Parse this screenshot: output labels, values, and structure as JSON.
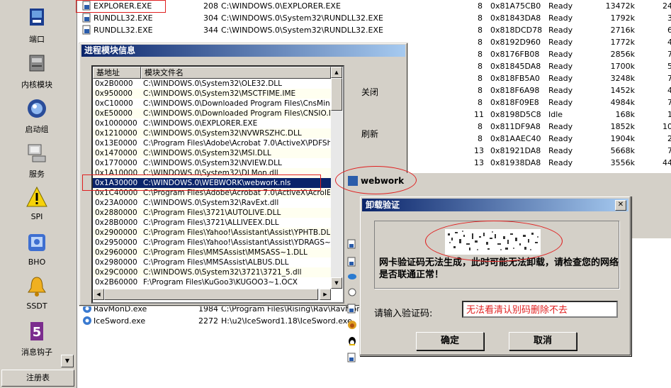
{
  "sidebar": {
    "items": [
      {
        "label": "端口",
        "icon": "port-icon"
      },
      {
        "label": "内核模块",
        "icon": "kernel-module-icon"
      },
      {
        "label": "启动组",
        "icon": "startup-group-icon"
      },
      {
        "label": "服务",
        "icon": "service-icon"
      },
      {
        "label": "SPI",
        "icon": "warning-icon"
      },
      {
        "label": "BHO",
        "icon": "bho-icon"
      },
      {
        "label": "SSDT",
        "icon": "bell-icon"
      },
      {
        "label": "消息钩子",
        "icon": "hook-icon"
      }
    ],
    "register_label": "注册表"
  },
  "processes": [
    {
      "name": "EXPLORER.EXE",
      "pid": "208",
      "path": "C:\\WINDOWS.0\\EXPLORER.EXE",
      "prio": "8",
      "addr": "0x81A75CB0",
      "state": "Ready",
      "mem": "13472k",
      "extra": "24"
    },
    {
      "name": "RUNDLL32.EXE",
      "pid": "304",
      "path": "C:\\WINDOWS.0\\System32\\RUNDLL32.EXE",
      "prio": "8",
      "addr": "0x81843DA8",
      "state": "Ready",
      "mem": "1792k",
      "extra": "3"
    },
    {
      "name": "RUNDLL32.EXE",
      "pid": "344",
      "path": "C:\\WINDOWS.0\\System32\\RUNDLL32.EXE",
      "prio": "8",
      "addr": "0x818DCD78",
      "state": "Ready",
      "mem": "2716k",
      "extra": "6"
    },
    {
      "name": "",
      "pid": "",
      "path": "",
      "prio": "8",
      "addr": "0x8192D960",
      "state": "Ready",
      "mem": "1772k",
      "extra": "4"
    },
    {
      "name": "",
      "pid": "",
      "path": "",
      "prio": "8",
      "addr": "0x8176FB08",
      "state": "Ready",
      "mem": "2856k",
      "extra": "7"
    },
    {
      "name": "",
      "pid": "",
      "path": "",
      "prio": "8",
      "addr": "0x81845DA8",
      "state": "Ready",
      "mem": "1700k",
      "extra": "5"
    },
    {
      "name": "",
      "pid": "",
      "path": "",
      "prio": "8",
      "addr": "0x818FB5A0",
      "state": "Ready",
      "mem": "3248k",
      "extra": "7"
    },
    {
      "name": "",
      "pid": "",
      "path": "",
      "prio": "8",
      "addr": "0x818F6A98",
      "state": "Ready",
      "mem": "1452k",
      "extra": "4"
    },
    {
      "name": "",
      "pid": "",
      "path": "",
      "prio": "8",
      "addr": "0x818F09E8",
      "state": "Ready",
      "mem": "4984k",
      "extra": "7"
    },
    {
      "name": "",
      "pid": "",
      "path": "",
      "prio": "11",
      "addr": "0x8198D5C8",
      "state": "Idle",
      "mem": "168k",
      "extra": "1"
    },
    {
      "name": "",
      "pid": "",
      "path": "",
      "prio": "8",
      "addr": "0x811DF9A8",
      "state": "Ready",
      "mem": "1852k",
      "extra": "10"
    },
    {
      "name": "",
      "pid": "",
      "path": "",
      "prio": "8",
      "addr": "0x81AAEC40",
      "state": "Ready",
      "mem": "1904k",
      "extra": "2"
    },
    {
      "name": "",
      "pid": "",
      "path": "",
      "prio": "13",
      "addr": "0x81921DA8",
      "state": "Ready",
      "mem": "5668k",
      "extra": "7"
    },
    {
      "name": "",
      "pid": "",
      "path": "",
      "prio": "13",
      "addr": "0x81938DA8",
      "state": "Ready",
      "mem": "3556k",
      "extra": "44"
    }
  ],
  "processes_bottom": [
    {
      "name": "RavMonD.exe",
      "pid": "1984",
      "path": "C:\\Program Files\\Rising\\Rav\\RavMonD.e"
    },
    {
      "name": "IceSword.exe",
      "pid": "2272",
      "path": "H:\\u2\\IceSword1.18\\IceSword.exe"
    }
  ],
  "module_window": {
    "title": "进程模块信息",
    "col_base": "基地址",
    "col_file": "模块文件名",
    "close_label": "关闭",
    "refresh_label": "刷新",
    "rows": [
      {
        "base": "0x2B0000",
        "file": "C:\\WINDOWS.0\\System32\\OLE32.DLL"
      },
      {
        "base": "0x950000",
        "file": "C:\\WINDOWS.0\\System32\\MSCTFIME.IME"
      },
      {
        "base": "0xC10000",
        "file": "C:\\WINDOWS.0\\Downloaded Program Files\\CnsMin.dll"
      },
      {
        "base": "0xE50000",
        "file": "C:\\WINDOWS.0\\Downloaded Program Files\\CNSIO.DLL"
      },
      {
        "base": "0x1000000",
        "file": "C:\\WINDOWS.0\\EXPLORER.EXE"
      },
      {
        "base": "0x1210000",
        "file": "C:\\WINDOWS.0\\System32\\NVWRSZHC.DLL"
      },
      {
        "base": "0x13E0000",
        "file": "C:\\Program Files\\Adobe\\Acrobat 7.0\\ActiveX\\PDFShell."
      },
      {
        "base": "0x1470000",
        "file": "C:\\WINDOWS.0\\System32\\MSI.DLL"
      },
      {
        "base": "0x1770000",
        "file": "C:\\WINDOWS.0\\System32\\NVIEW.DLL"
      },
      {
        "base": "0x1A10000",
        "file": "C:\\WINDOWS.0\\System32\\DLMon.dll"
      },
      {
        "base": "0x1A30000",
        "file": "C:\\WINDOWS.0\\WEBWORK\\webwork.nls"
      },
      {
        "base": "0x1C40000",
        "file": "C:\\Program Files\\Adobe\\Acrobat 7.0\\ActiveX\\AcroIEHe"
      },
      {
        "base": "0x23A0000",
        "file": "C:\\WINDOWS.0\\System32\\RavExt.dll"
      },
      {
        "base": "0x2880000",
        "file": "C:\\Program Files\\3721\\AUTOLIVE.DLL"
      },
      {
        "base": "0x28B0000",
        "file": "C:\\Program Files\\3721\\ALLIVEEX.DLL"
      },
      {
        "base": "0x2900000",
        "file": "C:\\Program Files\\Yahoo!\\Assistant\\Assist\\YPHTB.DLL"
      },
      {
        "base": "0x2950000",
        "file": "C:\\Program Files\\Yahoo!\\Assistant\\Assist\\YDRAGS~1.D"
      },
      {
        "base": "0x2960000",
        "file": "C:\\Program Files\\MMSAssist\\MMSASS~1.DLL"
      },
      {
        "base": "0x2980000",
        "file": "C:\\Program Files\\MMSAssist\\ALBUS.DLL"
      },
      {
        "base": "0x29C0000",
        "file": "C:\\WINDOWS.0\\System32\\3721\\3721_5.dll"
      },
      {
        "base": "0x2B60000",
        "file": "F:\\Program Files\\KuGoo3\\KUGOO3~1.OCX"
      }
    ]
  },
  "webwork_label": "webwork",
  "uninstall_dialog": {
    "title": "卸载验证",
    "close_glyph": "✕",
    "message": "网卡验证码无法生成，此时可能无法卸载，请检查您的网络是否联通正常！",
    "prompt": "请输入验证码:",
    "input_value": "无法看清认别码删除不去",
    "ok_label": "确定",
    "cancel_label": "取消"
  },
  "colors": {
    "titlebar": "#0a246a",
    "selection": "#0a246a",
    "annotation": "#e02020",
    "face": "#d4d0c8"
  }
}
